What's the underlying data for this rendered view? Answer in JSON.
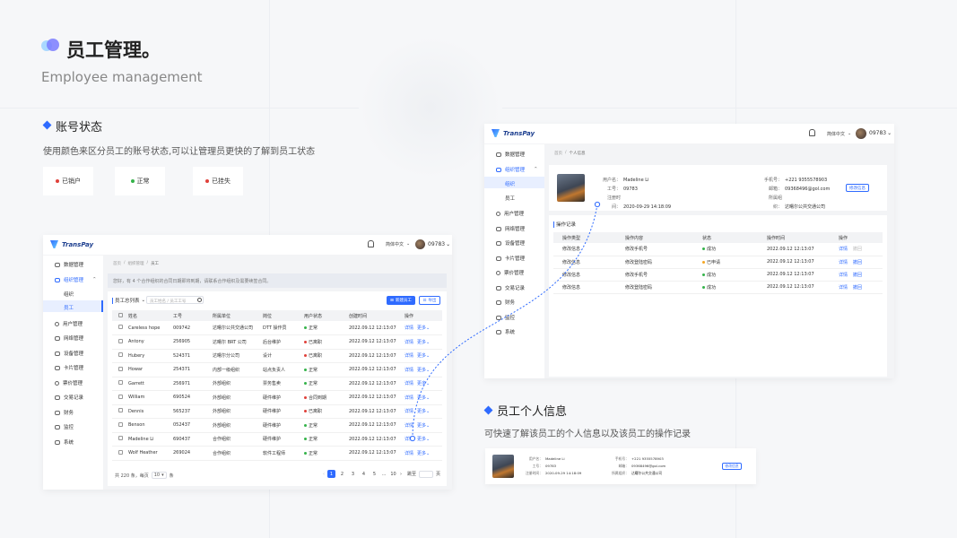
{
  "header": {
    "title": "员工管理。",
    "subtitle": "Employee management"
  },
  "account_status": {
    "title": "账号状态",
    "description": "使用颜色来区分员工的账号状态,可以让管理员更快的了解到员工状态",
    "chips": [
      {
        "label": "已销户",
        "color": "#e0403a"
      },
      {
        "label": "正常",
        "color": "#35b34a"
      },
      {
        "label": "已挂失",
        "color": "#e0403a"
      }
    ]
  },
  "employee_info": {
    "title": "员工个人信息",
    "description": "可快速了解该员工的个人信息以及该员工的操作记录"
  },
  "app": {
    "brand": "TransPay",
    "lang": "简体中文",
    "user": "09783",
    "menu": [
      "数据管理",
      "组织管理",
      "组织",
      "员工",
      "用户管理",
      "网络管理",
      "设备管理",
      "卡片管理",
      "票价管理",
      "交易记录",
      "财务",
      "监控",
      "系统"
    ]
  },
  "list_screen": {
    "breadcrumb": [
      "首页",
      "组织管理",
      "员工"
    ],
    "notice": "您好，有 4 个合作组织的合同日期即将到期，请联系合作组织及需要续签合同。",
    "filter_label": "员工总列表",
    "search_placeholder": "员工姓名 / 员工工号",
    "new_button": "新建员工",
    "export_button": "导出",
    "columns": [
      "姓名",
      "工号",
      "所属单位",
      "岗位",
      "用户状态",
      "创建时间",
      "操作"
    ],
    "rows": [
      {
        "name": "Careless hope",
        "id": "009742",
        "unit": "达曙尔公共交通公司",
        "post": "DTT 操作员",
        "status": "正常",
        "status_color": "#35b34a",
        "time": "2022.09.12  12:13:07"
      },
      {
        "name": "Antony",
        "id": "256905",
        "unit": "达曙尔 BRT 公司",
        "post": "后台维护",
        "status": "已离职",
        "status_color": "#e0403a",
        "time": "2022.09.12  12:13:07"
      },
      {
        "name": "Hubery",
        "id": "524371",
        "unit": "达曙尔分公司",
        "post": "设计",
        "status": "已离职",
        "status_color": "#e0403a",
        "time": "2022.09.12  12:13:07"
      },
      {
        "name": "Howar",
        "id": "254371",
        "unit": "内部一级组织",
        "post": "站点负责人",
        "status": "正常",
        "status_color": "#35b34a",
        "time": "2022.09.12  12:13:07"
      },
      {
        "name": "Garrett",
        "id": "256971",
        "unit": "外部组织",
        "post": "票务售卖",
        "status": "正常",
        "status_color": "#35b34a",
        "time": "2022.09.12  12:13:07"
      },
      {
        "name": "William",
        "id": "690524",
        "unit": "外部组织",
        "post": "硬件维护",
        "status": "合同到期",
        "status_color": "#e0403a",
        "time": "2022.09.12  12:13:07"
      },
      {
        "name": "Dennis",
        "id": "565237",
        "unit": "外部组织",
        "post": "硬件维护",
        "status": "已离职",
        "status_color": "#e0403a",
        "time": "2022.09.12  12:13:07"
      },
      {
        "name": "Benson",
        "id": "052437",
        "unit": "外部组织",
        "post": "硬件维护",
        "status": "正常",
        "status_color": "#35b34a",
        "time": "2022.09.12  12:13:07"
      },
      {
        "name": "Madeline Li",
        "id": "690437",
        "unit": "合作组织",
        "post": "硬件维护",
        "status": "正常",
        "status_color": "#35b34a",
        "time": "2022.09.12  12:13:07"
      },
      {
        "name": "Wolf Heather",
        "id": "269024",
        "unit": "合作组织",
        "post": "软件工程师",
        "status": "正常",
        "status_color": "#35b34a",
        "time": "2022.09.12  12:13:07"
      }
    ],
    "action_detail": "详情",
    "action_more": "更多",
    "footer_total": "共 220 条，每页",
    "footer_per_page": "10",
    "footer_unit": "条",
    "pages": [
      "1",
      "2",
      "3",
      "4",
      "5",
      "...",
      "10"
    ],
    "goto_label": "跳至",
    "goto_unit": "页"
  },
  "detail_screen": {
    "breadcrumb": [
      "首页",
      "个人信息"
    ],
    "labels": {
      "username": "用户名：",
      "id": "工号：",
      "register_time": "注册时间：",
      "phone": "手机号：",
      "email": "邮箱：",
      "org": "所属组织："
    },
    "values": {
      "username": "Madeline Li",
      "id": "09783",
      "register_time": "2020-09-29  14:18:09",
      "phone": "+221 9355578903",
      "email": "09368496@gol.com",
      "org": "达曙尔公共交通公司"
    },
    "edit_button": "修改信息",
    "section_title": "操作记录",
    "columns": [
      "操作类型",
      "操作内容",
      "状态",
      "操作时间",
      "操作"
    ],
    "rows": [
      {
        "type": "修改信息",
        "content": "修改手机号",
        "status": "成功",
        "status_color": "#35b34a",
        "time": "2022.09.12  12:13:07",
        "detail": "详情",
        "revoke": "撤回",
        "revoke_enabled": false
      },
      {
        "type": "修改信息",
        "content": "修改登陆密码",
        "status": "已申请",
        "status_color": "#f5a623",
        "time": "2022.09.12  12:13:07",
        "detail": "详情",
        "revoke": "撤回",
        "revoke_enabled": true
      },
      {
        "type": "修改信息",
        "content": "修改手机号",
        "status": "成功",
        "status_color": "#35b34a",
        "time": "2022.09.12  12:13:07",
        "detail": "详情",
        "revoke": "撤回",
        "revoke_enabled": true
      },
      {
        "type": "修改信息",
        "content": "修改登陆密码",
        "status": "成功",
        "status_color": "#35b34a",
        "time": "2022.09.12  12:13:07",
        "detail": "详情",
        "revoke": "撤回",
        "revoke_enabled": true
      }
    ]
  },
  "colors": {
    "accent": "#2f6bff",
    "success": "#35b34a",
    "danger": "#e0403a",
    "warning": "#f5a623"
  }
}
